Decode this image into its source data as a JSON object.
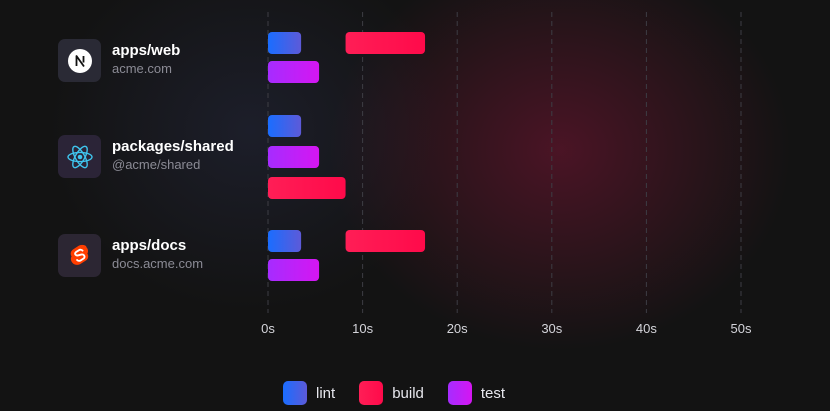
{
  "projects": [
    {
      "name": "apps/web",
      "subtitle": "acme.com",
      "icon": "nextjs-icon"
    },
    {
      "name": "packages/shared",
      "subtitle": "@acme/shared",
      "icon": "react-icon"
    },
    {
      "name": "apps/docs",
      "subtitle": "docs.acme.com",
      "icon": "svelte-icon"
    }
  ],
  "legend": [
    {
      "label": "lint",
      "color_from": "#1a6dff",
      "color_to": "#5d5ad8"
    },
    {
      "label": "build",
      "color_from": "#ff1e56",
      "color_to": "#ff0a4a"
    },
    {
      "label": "test",
      "color_from": "#a62cff",
      "color_to": "#d516f2"
    }
  ],
  "chart_data": {
    "type": "bar",
    "orientation": "horizontal",
    "task_timeline": true,
    "categories": [
      "apps/web",
      "packages/shared",
      "apps/docs"
    ],
    "x_ticks": [
      "0s",
      "10s",
      "20s",
      "30s",
      "40s",
      "50s"
    ],
    "xlim": [
      0,
      50
    ],
    "grid": "vertical dashed",
    "legend_position": "bottom",
    "series": [
      {
        "name": "lint",
        "tasks": [
          {
            "project": "apps/web",
            "start": 0,
            "end": 3.5
          },
          {
            "project": "packages/shared",
            "start": 0,
            "end": 3.5
          },
          {
            "project": "apps/docs",
            "start": 0,
            "end": 3.5
          }
        ]
      },
      {
        "name": "build",
        "tasks": [
          {
            "project": "apps/web",
            "start": 8.2,
            "end": 16.6
          },
          {
            "project": "packages/shared",
            "start": 0,
            "end": 8.2
          },
          {
            "project": "apps/docs",
            "start": 8.2,
            "end": 16.6
          }
        ]
      },
      {
        "name": "test",
        "tasks": [
          {
            "project": "apps/web",
            "start": 0,
            "end": 5.4
          },
          {
            "project": "packages/shared",
            "start": 0,
            "end": 5.4
          },
          {
            "project": "apps/docs",
            "start": 0,
            "end": 5.4
          }
        ]
      }
    ]
  }
}
